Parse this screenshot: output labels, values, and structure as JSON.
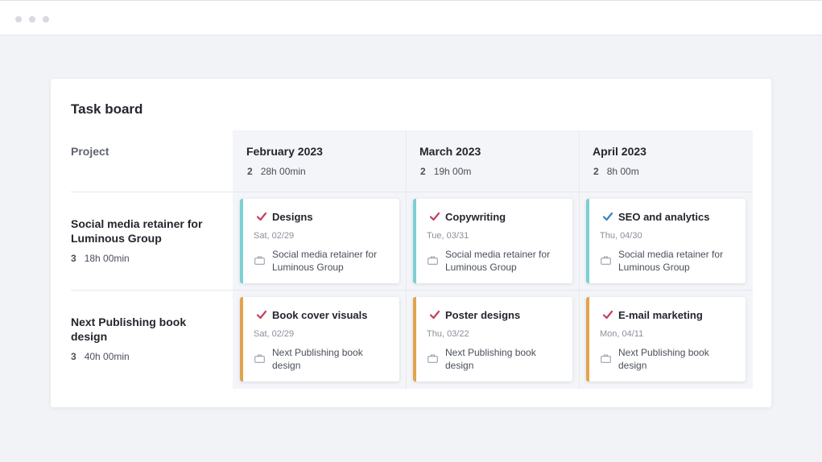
{
  "board": {
    "title": "Task board",
    "project_header": "Project"
  },
  "months": [
    {
      "name": "February 2023",
      "count": "2",
      "hours": "28h 00min"
    },
    {
      "name": "March 2023",
      "count": "2",
      "hours": "19h 00m"
    },
    {
      "name": "April 2023",
      "count": "2",
      "hours": "8h 00m"
    }
  ],
  "projects": [
    {
      "name": "Social media retainer for Luminous Group",
      "count": "3",
      "hours": "18h 00min"
    },
    {
      "name": "Next Publishing book design",
      "count": "3",
      "hours": "40h 00min"
    }
  ],
  "cards": [
    {
      "title": "Designs",
      "date": "Sat, 02/29",
      "project": "Social media retainer for Luminous Group",
      "check_color": "#c2415d",
      "accent": "#7ccfd3"
    },
    {
      "title": "Copywriting",
      "date": "Tue, 03/31",
      "project": "Social media retainer for Luminous Group",
      "check_color": "#c2415d",
      "accent": "#7ccfd3"
    },
    {
      "title": "SEO and analytics",
      "date": "Thu, 04/30",
      "project": "Social media retainer for Luminous Group",
      "check_color": "#3b7fc4",
      "accent": "#7ccfd3"
    },
    {
      "title": "Book cover visuals",
      "date": "Sat, 02/29",
      "project": "Next Publishing book design",
      "check_color": "#c2415d",
      "accent": "#e3a34d"
    },
    {
      "title": "Poster designs",
      "date": "Thu, 03/22",
      "project": "Next Publishing book design",
      "check_color": "#c2415d",
      "accent": "#e3a34d"
    },
    {
      "title": "E-mail marketing",
      "date": "Mon, 04/11",
      "project": "Next Publishing book design",
      "check_color": "#c2415d",
      "accent": "#e3a34d"
    }
  ],
  "icons": {
    "check": "check-icon",
    "project": "briefcase-icon"
  }
}
